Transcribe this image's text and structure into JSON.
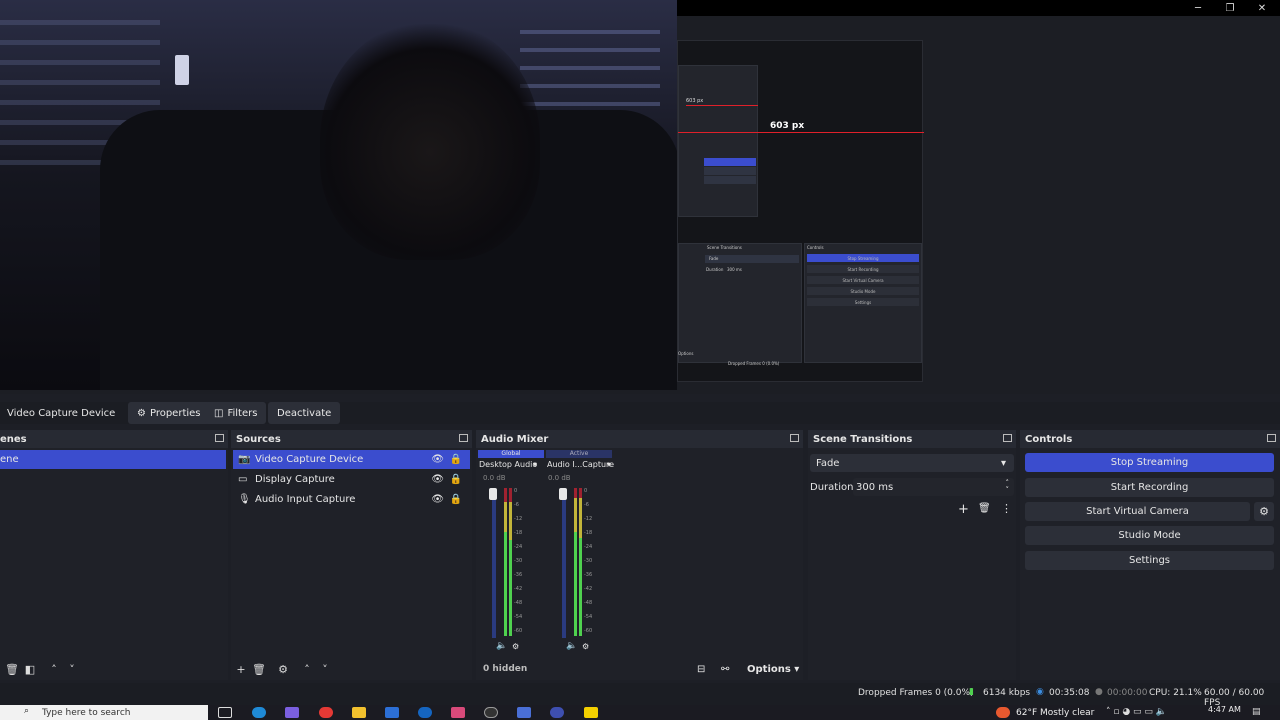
{
  "window": {
    "minimize": "─",
    "maximize": "❐",
    "close": "✕"
  },
  "preview": {
    "nested_label": "603 px",
    "nested_small_label": "603 px",
    "nested_scene_transitions": "Scene Transitions",
    "nested_controls": "Controls",
    "nested_fade": "Fade",
    "nested_duration": "Duration",
    "nested_ms": "300 ms",
    "nested_buttons": [
      "Stop Streaming",
      "Start Recording",
      "Start Virtual Camera",
      "Studio Mode",
      "Settings"
    ],
    "nested_status": "Dropped Frames 0 (0.0%)",
    "nested_options": "Options"
  },
  "toolbar": {
    "source_name": "Video Capture Device",
    "properties": "Properties",
    "filters": "Filters",
    "deactivate": "Deactivate"
  },
  "scenes": {
    "title": "enes",
    "items": [
      {
        "label": "ene",
        "selected": true
      }
    ]
  },
  "sources": {
    "title": "Sources",
    "items": [
      {
        "label": "Video Capture Device",
        "icon": "camera-icon",
        "selected": true
      },
      {
        "label": "Display Capture",
        "icon": "monitor-icon",
        "selected": false
      },
      {
        "label": "Audio Input Capture",
        "icon": "microphone-icon",
        "selected": false
      }
    ]
  },
  "audio_mixer": {
    "title": "Audio Mixer",
    "badge_global": "Global",
    "badge_active": "Active",
    "channels": [
      {
        "name": "Desktop Audio",
        "db": "0.0 dB"
      },
      {
        "name": "Audio I...Capture",
        "db": "0.0 dB"
      }
    ],
    "ticks": [
      "0",
      "-6",
      "-12",
      "-18",
      "-24",
      "-30",
      "-36",
      "-42",
      "-48",
      "-54",
      "-60"
    ],
    "hidden": "0 hidden",
    "options": "Options"
  },
  "scene_transitions": {
    "title": "Scene Transitions",
    "transition": "Fade",
    "duration_label": "Duration",
    "duration_value": "300 ms"
  },
  "controls": {
    "title": "Controls",
    "stop_streaming": "Stop Streaming",
    "start_recording": "Start Recording",
    "start_virtual_camera": "Start Virtual Camera",
    "studio_mode": "Studio Mode",
    "settings": "Settings"
  },
  "status": {
    "dropped_frames": "Dropped Frames 0 (0.0%)",
    "bitrate": "6134 kbps",
    "stream_time": "00:35:08",
    "record_time": "00:00:00",
    "cpu": "CPU: 21.1%",
    "fps": "60.00 / 60.00 FPS"
  },
  "taskbar": {
    "search_placeholder": "Type here to search",
    "weather": "62°F  Mostly clear",
    "time": "4:47 AM"
  },
  "colors": {
    "accent": "#3b4dce",
    "live_red": "#e0202a",
    "meter_green": "#4fd14f"
  }
}
